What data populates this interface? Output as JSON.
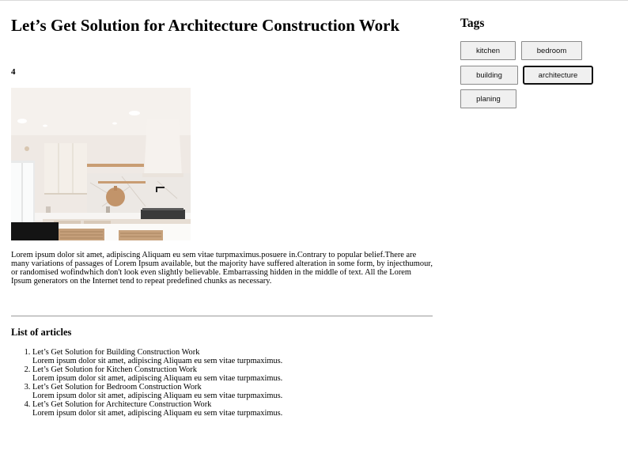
{
  "article": {
    "title": "Let’s Get Solution for Architecture Construction Work",
    "number": "4",
    "body": "Lorem ipsum dolor sit amet, adipiscing Aliquam eu sem vitae turpmaximus.posuere in.Contrary to popular belief.There are many variations of passages of Lorem Ipsum available, but the majority have suffered alteration in some form, by injecthumour, or randomised wofindwhich don't look even slightly believable. Embarrassing hidden in the middle of text. All the Lorem Ipsum generators on the Internet tend to repeat predefined chunks as necessary.",
    "image": "kitchen-photo"
  },
  "list": {
    "heading": "List of articles",
    "items": [
      {
        "title": "Let’s Get Solution for Building Construction Work",
        "summary": "Lorem ipsum dolor sit amet, adipiscing Aliquam eu sem vitae turpmaximus."
      },
      {
        "title": "Let’s Get Solution for Kitchen Construction Work",
        "summary": "Lorem ipsum dolor sit amet, adipiscing Aliquam eu sem vitae turpmaximus."
      },
      {
        "title": "Let’s Get Solution for Bedroom Construction Work",
        "summary": "Lorem ipsum dolor sit amet, adipiscing Aliquam eu sem vitae turpmaximus."
      },
      {
        "title": "Let’s Get Solution for Architecture Construction Work",
        "summary": "Lorem ipsum dolor sit amet, adipiscing Aliquam eu sem vitae turpmaximus."
      }
    ]
  },
  "sidebar": {
    "heading": "Tags",
    "tags": [
      {
        "label": "kitchen",
        "active": false
      },
      {
        "label": "bedroom",
        "active": false
      },
      {
        "label": "building",
        "active": false
      },
      {
        "label": "architecture",
        "active": true
      },
      {
        "label": "planing",
        "active": false
      }
    ]
  }
}
